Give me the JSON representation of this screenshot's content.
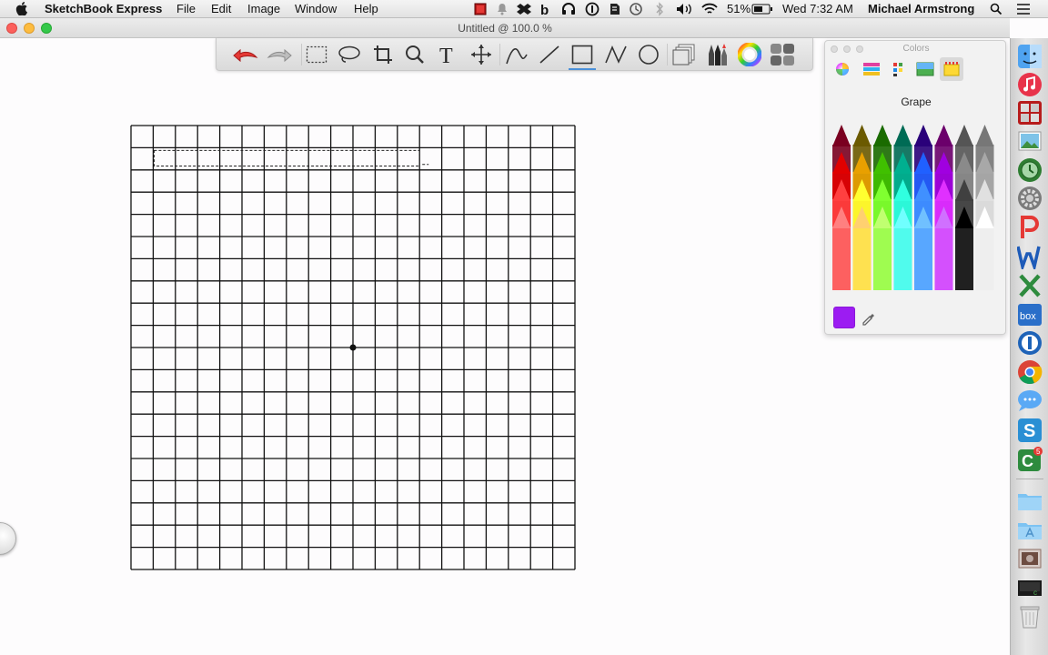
{
  "menubar": {
    "app_name": "SketchBook Express",
    "menus": [
      "File",
      "Edit",
      "Image",
      "Window",
      "Help"
    ],
    "battery": "51%",
    "clock": "Wed 7:32 AM",
    "user": "Michael Armstrong"
  },
  "window": {
    "title": "Untitled @ 100.0 %"
  },
  "toolbar": {
    "tools": [
      "undo",
      "redo",
      "rect-select",
      "lasso",
      "crop",
      "zoom",
      "text",
      "move",
      "curve",
      "line",
      "rectangle",
      "polyline",
      "ellipse",
      "layers",
      "brushes",
      "color-wheel",
      "palettes"
    ],
    "active_tool": "rectangle"
  },
  "colors_panel": {
    "title": "Colors",
    "color_name": "Grape",
    "selected_color": "#9c1cf2",
    "tabs": [
      "color-wheel",
      "color-sliders",
      "color-palettes",
      "image-palettes",
      "crayons"
    ],
    "selected_tab": "crayons"
  },
  "canvas": {
    "grid_columns": 20,
    "grid_rows": 20
  },
  "dock": {
    "items": [
      "finder",
      "itunes",
      "photo-booth",
      "iphoto",
      "time-machine",
      "system-preferences",
      "pdf-app",
      "word",
      "excel",
      "box",
      "1password",
      "chrome",
      "messages",
      "sketchbook-express",
      "camtasia",
      "folder",
      "applications",
      "downloads",
      "stack",
      "trash"
    ],
    "badges": {
      "camtasia": "5"
    }
  }
}
